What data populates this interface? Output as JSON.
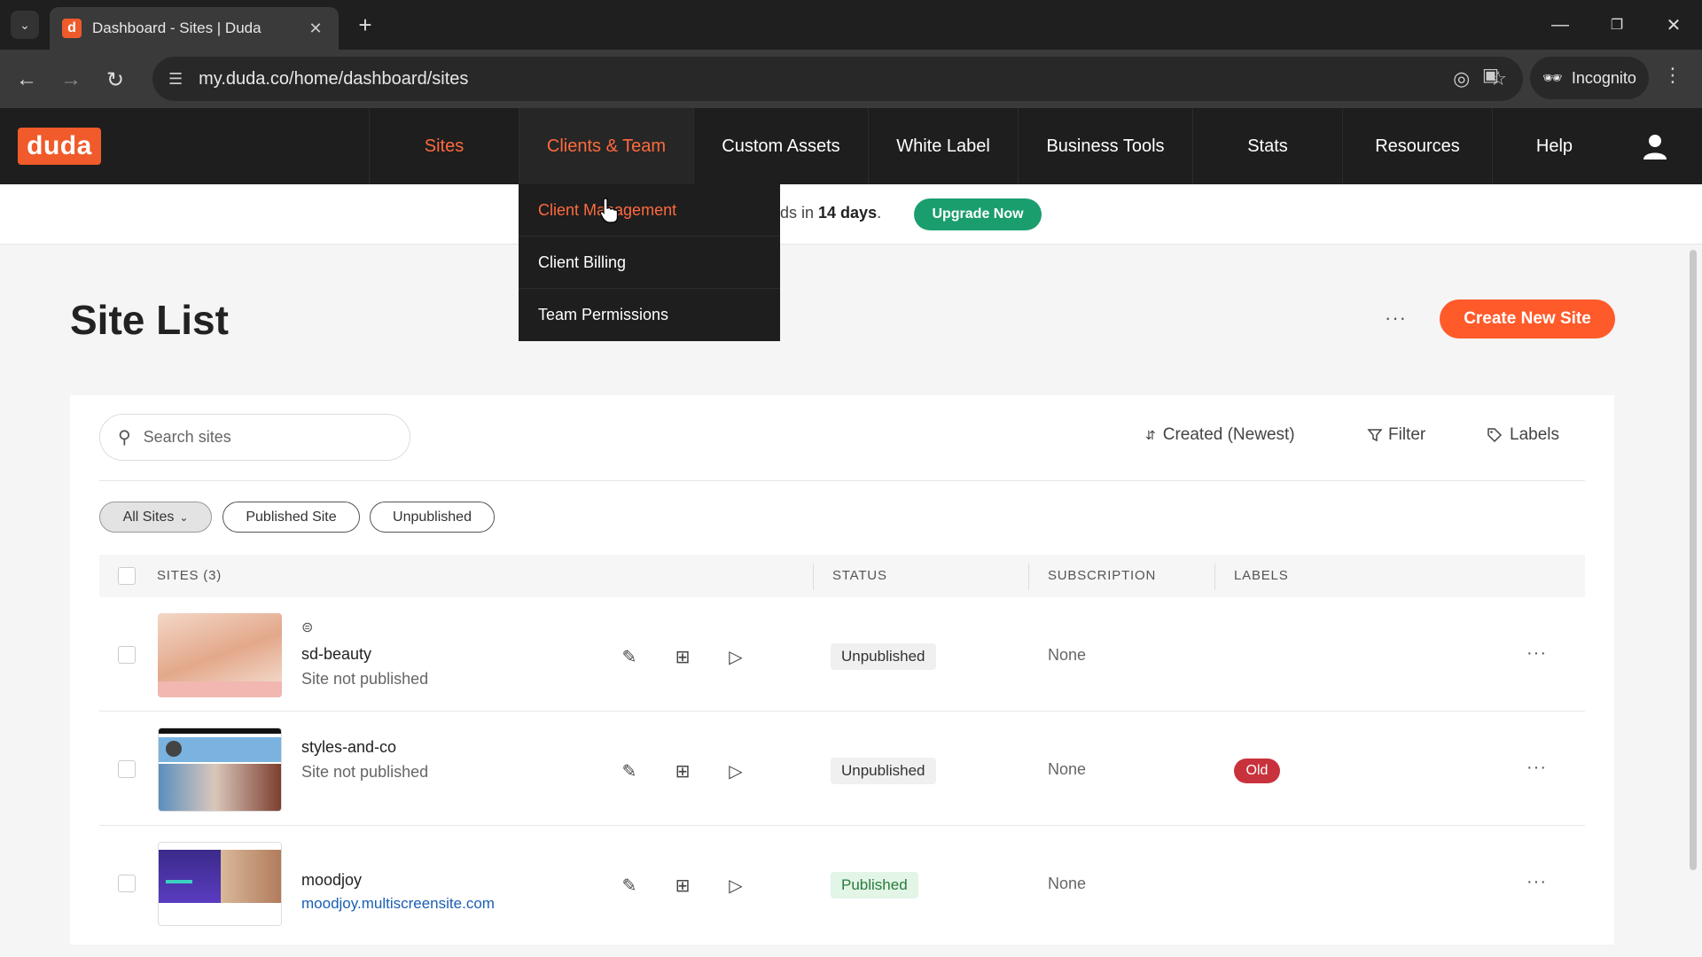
{
  "browser": {
    "tab_title": "Dashboard - Sites | Duda",
    "favicon_letter": "d",
    "url": "my.duda.co/home/dashboard/sites",
    "incognito_label": "Incognito"
  },
  "nav": {
    "logo": "duda",
    "items": [
      {
        "label": "Sites"
      },
      {
        "label": "Clients & Team"
      },
      {
        "label": "Custom Assets"
      },
      {
        "label": "White Label"
      },
      {
        "label": "Business Tools"
      },
      {
        "label": "Stats"
      },
      {
        "label": "Resources"
      },
      {
        "label": "Help"
      }
    ]
  },
  "dropdown": {
    "items": [
      {
        "label": "Client Management"
      },
      {
        "label": "Client Billing"
      },
      {
        "label": "Team Permissions"
      }
    ]
  },
  "banner": {
    "text_prefix": "ds in ",
    "days": "14 days",
    "text_suffix": ".",
    "upgrade_label": "Upgrade Now"
  },
  "page": {
    "title": "Site List",
    "more": "···",
    "create_label": "Create New Site"
  },
  "toolbar": {
    "search_placeholder": "Search sites",
    "sort_label": "Created (Newest)",
    "filter_label": "Filter",
    "labels_label": "Labels"
  },
  "filters": {
    "all": "All Sites",
    "published": "Published Site",
    "unpublished": "Unpublished"
  },
  "table": {
    "headers": {
      "sites": "SITES (3)",
      "status": "STATUS",
      "subscription": "SUBSCRIPTION",
      "labels": "LABELS"
    },
    "rows": [
      {
        "name": "sd-beauty",
        "sub": "Site not published",
        "status": "Unpublished",
        "subscription": "None",
        "label": ""
      },
      {
        "name": "styles-and-co",
        "sub": "Site not published",
        "status": "Unpublished",
        "subscription": "None",
        "label": "Old"
      },
      {
        "name": "moodjoy",
        "sub": "moodjoy.multiscreensite.com",
        "status": "Published",
        "subscription": "None",
        "label": ""
      }
    ]
  },
  "colors": {
    "accent": "#ff5a2a",
    "upgrade": "#1a9e6e",
    "label_old": "#c8323c"
  }
}
